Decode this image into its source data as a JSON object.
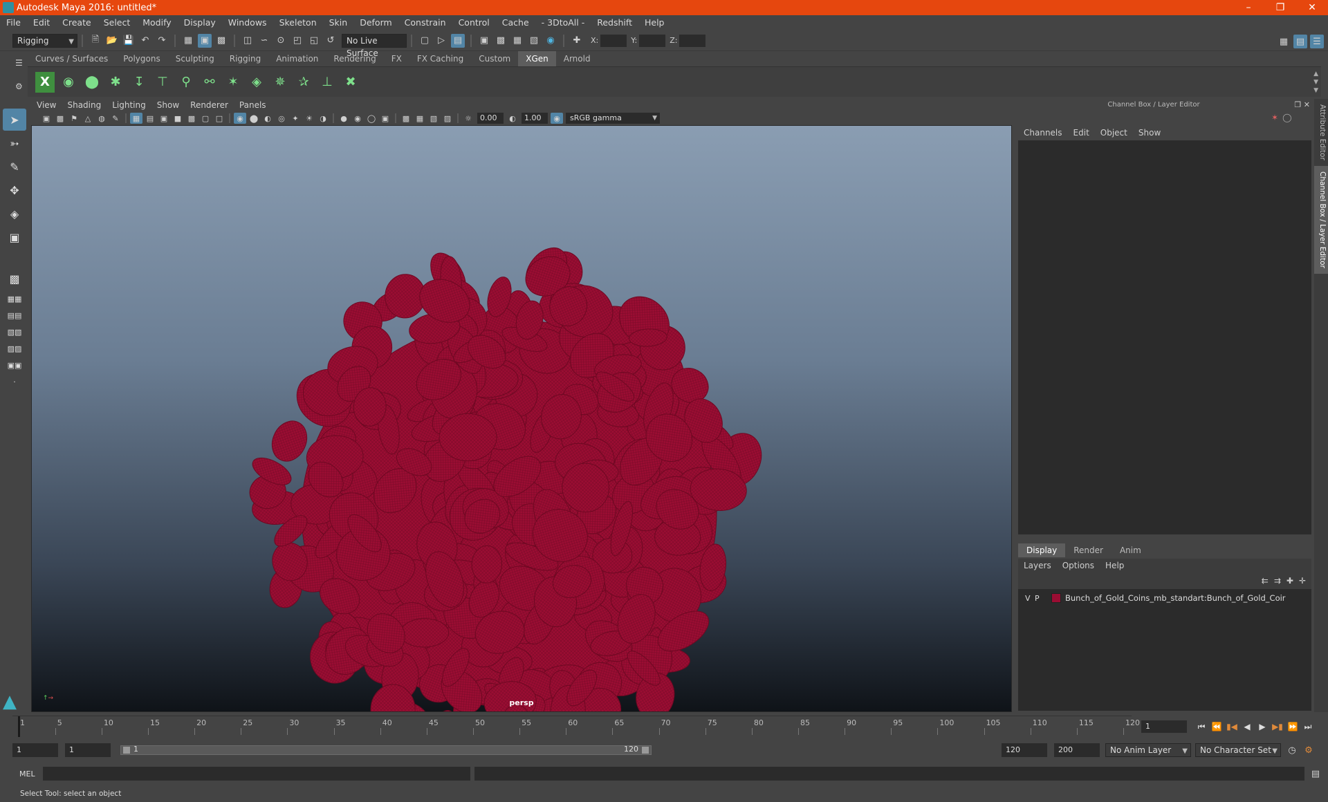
{
  "title_bar": {
    "title": "Autodesk Maya 2016: untitled*"
  },
  "menu_bar": [
    "File",
    "Edit",
    "Create",
    "Select",
    "Modify",
    "Display",
    "Windows",
    "Skeleton",
    "Skin",
    "Deform",
    "Constrain",
    "Control",
    "Cache",
    "- 3DtoAll -",
    "Redshift",
    "Help"
  ],
  "status_line": {
    "menu_set": "Rigging",
    "live_surface": "No Live Surface",
    "x_label": "X:",
    "y_label": "Y:",
    "z_label": "Z:"
  },
  "shelf_tabs": [
    "Curves / Surfaces",
    "Polygons",
    "Sculpting",
    "Rigging",
    "Animation",
    "Rendering",
    "FX",
    "FX Caching",
    "Custom",
    "XGen",
    "Arnold"
  ],
  "active_shelf_tab": "XGen",
  "viewport": {
    "menu": [
      "View",
      "Shading",
      "Lighting",
      "Show",
      "Renderer",
      "Panels"
    ],
    "exposure": "0.00",
    "gamma_value": "1.00",
    "color_space": "sRGB gamma",
    "camera": "persp",
    "mesh_color": "#9b0d33"
  },
  "channel_box": {
    "title": "Channel Box / Layer Editor",
    "menu": [
      "Channels",
      "Edit",
      "Object",
      "Show"
    ]
  },
  "layer_editor": {
    "tabs": [
      "Display",
      "Render",
      "Anim"
    ],
    "active_tab": "Display",
    "menu": [
      "Layers",
      "Options",
      "Help"
    ],
    "layers": [
      {
        "v": "V",
        "p": "P",
        "name": "Bunch_of_Gold_Coins_mb_standart:Bunch_of_Gold_Coir",
        "color": "#9b0d33"
      }
    ]
  },
  "side_tabs": [
    "Attribute Editor",
    "Channel Box / Layer Editor"
  ],
  "time_slider": {
    "ticks": [
      "1",
      "5",
      "10",
      "15",
      "20",
      "25",
      "30",
      "35",
      "40",
      "45",
      "50",
      "55",
      "60",
      "65",
      "70",
      "75",
      "80",
      "85",
      "90",
      "95",
      "100",
      "105",
      "110",
      "115",
      "120"
    ],
    "current_frame": "1"
  },
  "range_slider": {
    "start": "1",
    "playback_start": "1",
    "range_start_label": "1",
    "range_end_label": "120",
    "playback_end": "120",
    "end": "200",
    "anim_layer": "No Anim Layer",
    "character_set": "No Character Set"
  },
  "command_line": {
    "label": "MEL"
  },
  "help_line": {
    "text": "Select Tool: select an object"
  }
}
